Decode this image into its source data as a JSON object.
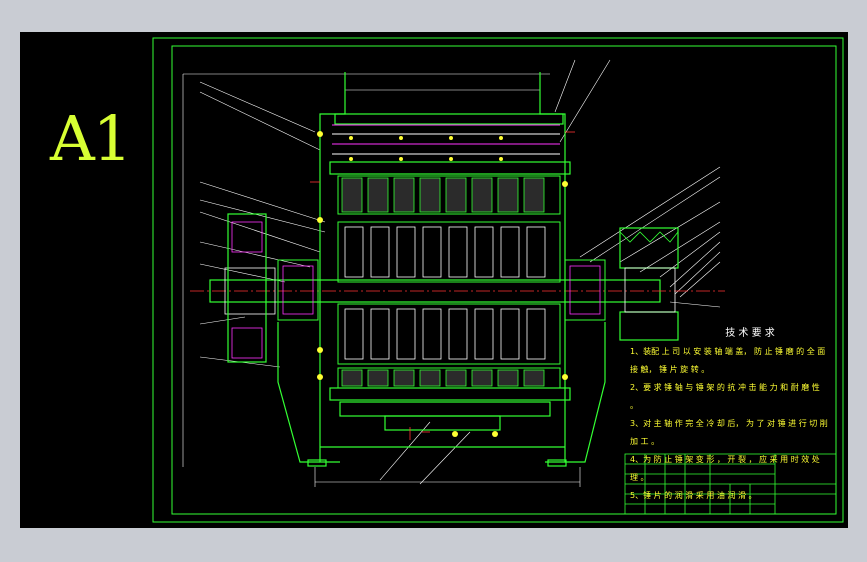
{
  "sheet_size": "A1",
  "technical_requirements": {
    "title": "技 术 要 求",
    "items": [
      "1、装配 上 司 以 安 装 轴 端 盖， 防 止 锤 磨 的 全 面 接 触， 锤 片 旋 转 。",
      "2、要 求 锤 轴 与 锤 架 的 抗 冲 击 能 力 和 耐 磨 性 。",
      "3、对 主 轴 作 完 全 冷 却 后， 为 了 对 锤 进 行 切 削 加 工 。",
      "4、为 防 止 锤 架 变 形 ， 开 裂 ， 应 采 用 时 效 处 理 。",
      "5、锤 片 的 润 滑 采 用 油 润 滑 。"
    ]
  },
  "colors": {
    "background": "#000000",
    "outline": "#33ff33",
    "centerline": "#ff3333",
    "text": "#ffffff",
    "accent": "#ffff33",
    "hatch": "#ff33ff"
  }
}
